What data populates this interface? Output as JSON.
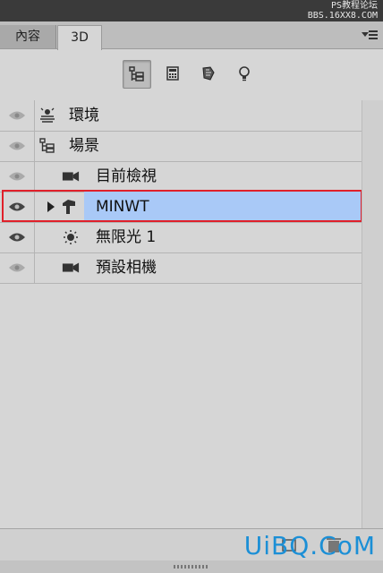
{
  "watermark_top": {
    "line1": "PS教程论坛",
    "line2": "BBS.16XX8.COM"
  },
  "watermark_bottom": "UiBQ.CoM",
  "tabs": [
    {
      "label": "內容",
      "active": false
    },
    {
      "label": "3D",
      "active": true
    }
  ],
  "filters": [
    {
      "icon": "scene-filter-icon",
      "selected": true
    },
    {
      "icon": "mesh-filter-icon",
      "selected": false
    },
    {
      "icon": "material-filter-icon",
      "selected": false
    },
    {
      "icon": "light-filter-icon",
      "selected": false
    }
  ],
  "layers": [
    {
      "label": "環境",
      "icon": "environment-icon",
      "visible": true
    },
    {
      "label": "場景",
      "icon": "scene-icon",
      "visible": true
    },
    {
      "label": "目前檢視",
      "icon": "camera-icon",
      "visible": true
    },
    {
      "label": "MINWT",
      "icon": "mesh-icon",
      "visible": true,
      "selected": true,
      "expandable": true
    },
    {
      "label": "無限光 1",
      "icon": "infinite-light-icon",
      "visible": true
    },
    {
      "label": "預設相機",
      "icon": "camera-icon",
      "visible": true
    }
  ],
  "colors": {
    "selection": "#a9c9f7",
    "highlight_frame": "#e0202a",
    "watermark": "#1b8fd6"
  }
}
